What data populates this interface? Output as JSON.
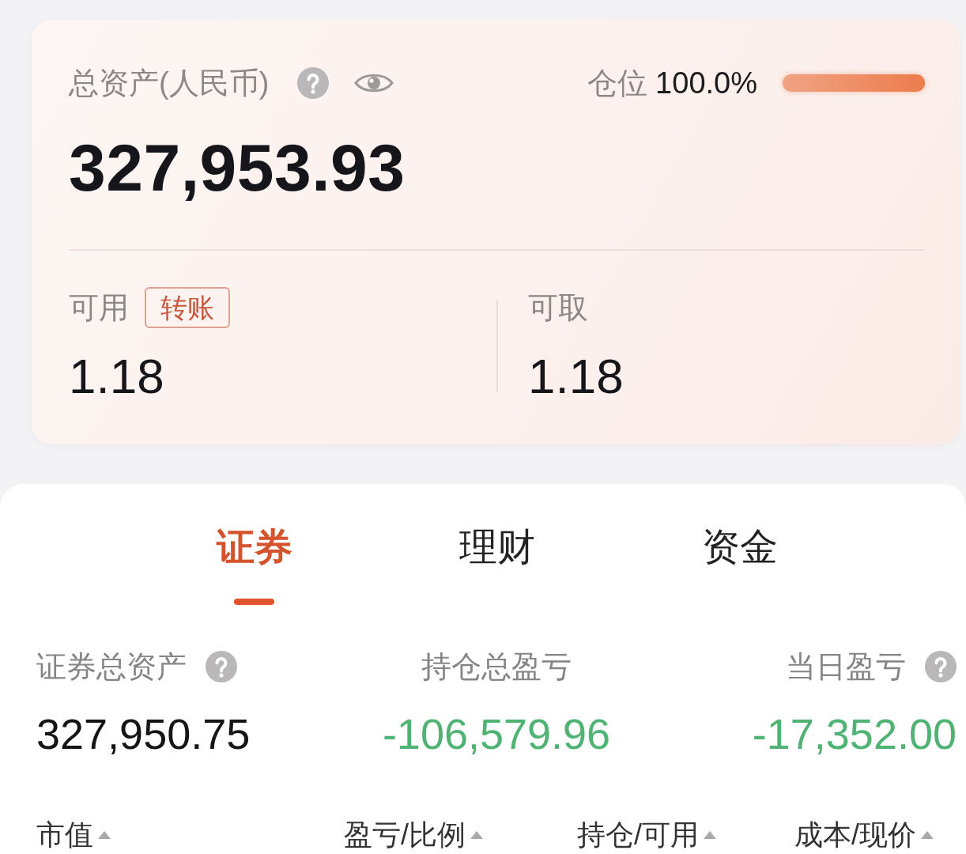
{
  "summary": {
    "label": "总资产(人民币)",
    "help": true,
    "visibility_toggle": true,
    "total": "327,953.93",
    "position": {
      "label": "仓位",
      "value": "100.0%",
      "level": 1.0
    },
    "available": {
      "label": "可用",
      "button": "转账",
      "value": "1.18"
    },
    "withdrawable": {
      "label": "可取",
      "value": "1.18"
    }
  },
  "tabs": [
    {
      "label": "证券",
      "selected": true
    },
    {
      "label": "理财",
      "selected": false
    },
    {
      "label": "资金",
      "selected": false
    }
  ],
  "stats": [
    {
      "label": "证券总资产",
      "help": true,
      "value": "327,950.75",
      "kind": "neutral"
    },
    {
      "label": "持仓总盈亏",
      "help": false,
      "value": "-106,579.96",
      "kind": "loss"
    },
    {
      "label": "当日盈亏",
      "help": true,
      "value": "-17,352.00",
      "kind": "loss"
    }
  ],
  "columns": [
    {
      "label": "市值",
      "sortable": true
    },
    {
      "label": "盈亏/比例",
      "sortable": true
    },
    {
      "label": "持仓/可用",
      "sortable": true
    },
    {
      "label": "成本/现价",
      "sortable": true
    }
  ]
}
